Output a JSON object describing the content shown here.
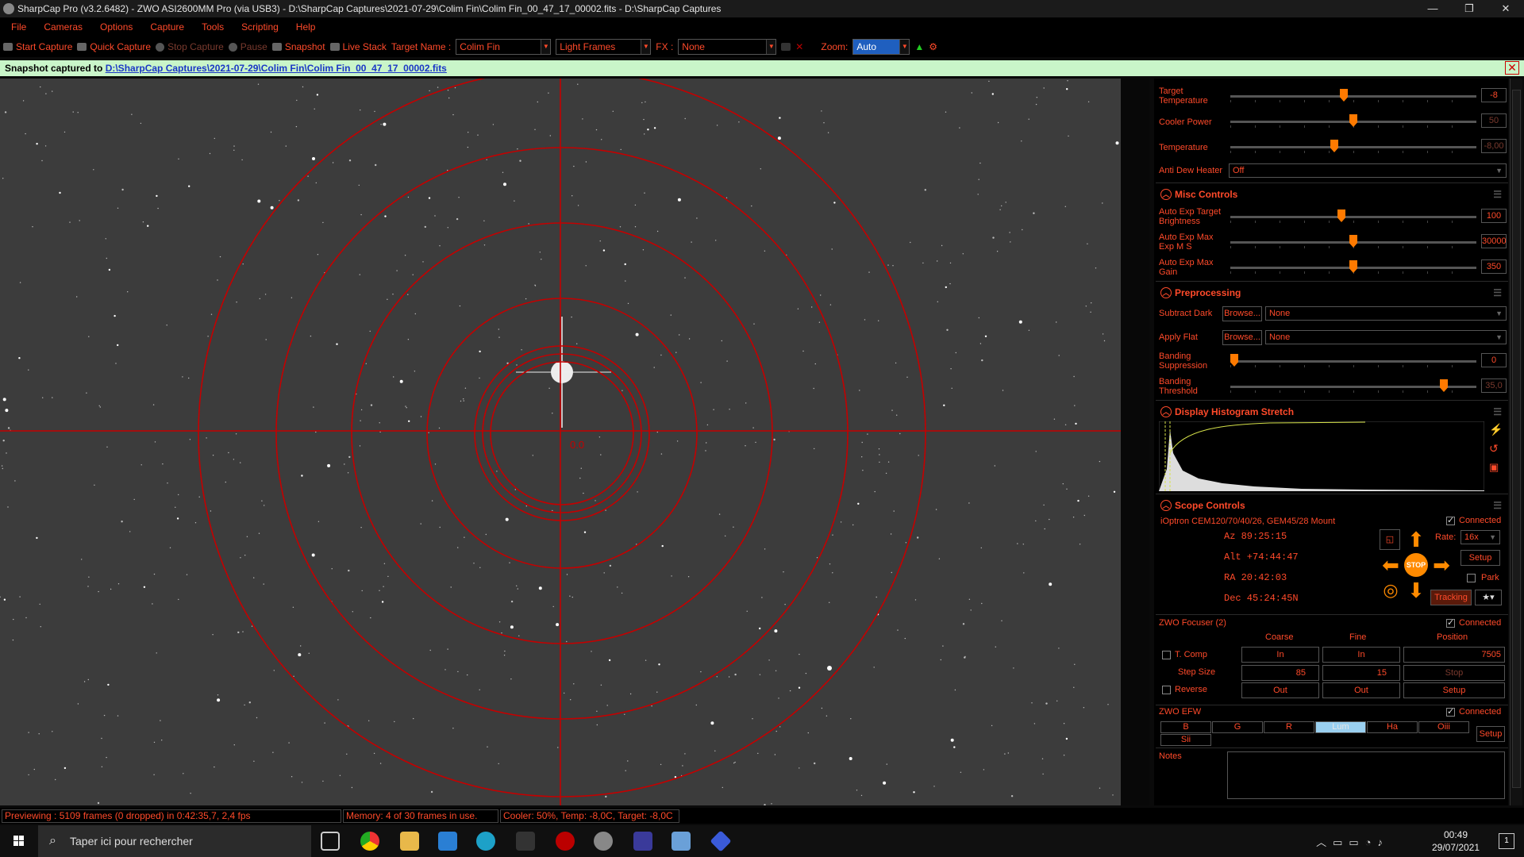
{
  "titlebar": {
    "title": "SharpCap Pro (v3.2.6482) - ZWO ASI2600MM Pro (via USB3) - D:\\SharpCap Captures\\2021-07-29\\Colim Fin\\Colim Fin_00_47_17_00002.fits - D:\\SharpCap Captures"
  },
  "menu": [
    "File",
    "Cameras",
    "Options",
    "Capture",
    "Tools",
    "Scripting",
    "Help"
  ],
  "toolbar": {
    "start_capture": "Start Capture",
    "quick_capture": "Quick Capture",
    "stop_capture": "Stop Capture",
    "pause": "Pause",
    "snapshot": "Snapshot",
    "live_stack": "Live Stack",
    "target_name_label": "Target Name :",
    "target_name_value": "Colim Fin",
    "frame_type": "Light Frames",
    "fx_label": "FX :",
    "fx_value": "None",
    "zoom_label": "Zoom:",
    "zoom_value": "Auto"
  },
  "notification": {
    "prefix": "Snapshot captured to",
    "path": "D:\\SharpCap Captures\\2021-07-29\\Colim Fin\\Colim Fin_00_47_17_00002.fits"
  },
  "reticle": {
    "center_label": "0.0",
    "color": "#d00000"
  },
  "cooler": {
    "rows": [
      {
        "label": "Target Temperature",
        "value": "-8",
        "level": 0.46,
        "dim": false
      },
      {
        "label": "Cooler Power",
        "value": "50",
        "level": 0.5,
        "dim": true
      },
      {
        "label": "Temperature",
        "value": "-8,00",
        "level": 0.42,
        "dim": true
      }
    ],
    "anti_dew_label": "Anti Dew Heater",
    "anti_dew_value": "Off"
  },
  "misc": {
    "title": "Misc Controls",
    "rows": [
      {
        "label": "Auto Exp Target Brightness",
        "value": "100",
        "level": 0.45
      },
      {
        "label": "Auto Exp Max Exp M S",
        "value": "30000",
        "level": 0.5
      },
      {
        "label": "Auto Exp Max Gain",
        "value": "350",
        "level": 0.5
      }
    ]
  },
  "pre": {
    "title": "Preprocessing",
    "subtract_dark_label": "Subtract Dark",
    "apply_flat_label": "Apply Flat",
    "browse": "Browse...",
    "dark_value": "None",
    "flat_value": "None",
    "banding_suppression_label": "Banding Suppression",
    "banding_suppression_value": "0",
    "banding_suppression_level": 0.0,
    "banding_threshold_label": "Banding Threshold",
    "banding_threshold_value": "35,0",
    "banding_threshold_level": 0.88
  },
  "histogram": {
    "title": "Display Histogram Stretch"
  },
  "scope": {
    "title": "Scope Controls",
    "mount": "iOptron CEM120/70/40/26, GEM45/28 Mount",
    "connected": "Connected",
    "az": "Az  89:25:15",
    "alt": "Alt +74:44:47",
    "ra": "RA  20:42:03",
    "dec": "Dec  45:24:45N",
    "rate_label": "Rate:",
    "rate_value": "16x",
    "setup": "Setup",
    "park": "Park",
    "stop": "STOP",
    "tracking": "Tracking"
  },
  "focuser": {
    "title": "ZWO Focuser (2)",
    "connected": "Connected",
    "coarse": "Coarse",
    "fine": "Fine",
    "position": "Position",
    "tcomp": "T. Comp",
    "step_size": "Step Size",
    "reverse": "Reverse",
    "in": "In",
    "out": "Out",
    "coarse_step": "85",
    "fine_step": "15",
    "position_value": "7505",
    "stop": "Stop",
    "setup": "Setup"
  },
  "efw": {
    "title": "ZWO EFW",
    "connected": "Connected",
    "filters": [
      "B",
      "G",
      "R",
      "Lum",
      "Ha",
      "Oiii",
      "Sii"
    ],
    "selected": "Lum",
    "setup": "Setup"
  },
  "notes": {
    "label": "Notes"
  },
  "status": {
    "preview": "Previewing : 5109 frames (0 dropped) in 0:42:35,7, 2,4 fps",
    "memory": "Memory: 4 of 30 frames in use.",
    "cooler": "Cooler: 50%, Temp: -8,0C, Target: -8,0C"
  },
  "taskbar": {
    "search_placeholder": "Taper ici pour rechercher",
    "time": "00:49",
    "date": "29/07/2021",
    "notif_count": "1"
  }
}
